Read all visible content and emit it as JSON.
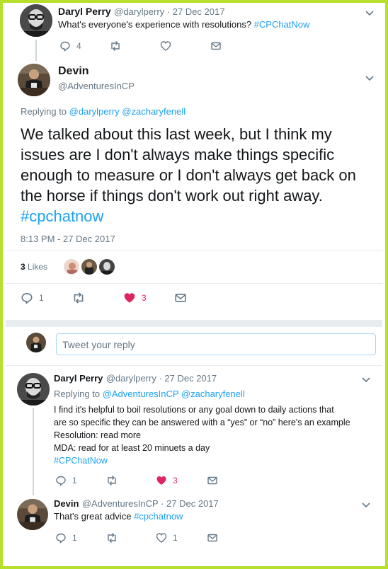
{
  "tweet1": {
    "name": "Daryl Perry",
    "handle_time": "@darylperry · 27 Dec 2017",
    "text": "What's everyone's experience with resolutions?",
    "hashtag": "#CPChatNow",
    "replies": "4"
  },
  "main": {
    "name": "Devin",
    "handle": "@AdventuresInCP",
    "replying_prefix": "Replying to",
    "reply_to_1": "@darylperry",
    "reply_to_2": "@zacharyfenell",
    "text": "We talked about this last week, but I think my issues are I don't always make things specific enough to measure or I don't always get back on the horse if things don't work out right away.",
    "hashtag": "#cpchatnow",
    "timestamp": "8:13 PM - 27 Dec 2017",
    "likes_count": "3",
    "likes_label": "Likes",
    "replies": "1",
    "likes": "3"
  },
  "compose": {
    "placeholder": "Tweet your reply"
  },
  "reply1": {
    "name": "Daryl Perry",
    "handle_time": "@darylperry · 27 Dec 2017",
    "replying_prefix": "Replying to",
    "reply_to_1": "@AdventuresInCP",
    "reply_to_2": "@zacharyfenell",
    "line1": "I find it's helpful to boil resolutions or any goal down to daily actions that",
    "line2": "are so specific they can be answered with a “yes” or “no”  here's an example",
    "line3": "Resolution: read more",
    "line4": "MDA: read for at least 20 minuets a day",
    "hashtag": "#CPChatNow",
    "replies": "1",
    "likes": "3"
  },
  "reply2": {
    "name": "Devin",
    "handle_time": "@AdventuresInCP · 27 Dec 2017",
    "text": "That's great advice",
    "hashtag": "#cpchatnow",
    "replies": "1",
    "likes": "1"
  },
  "colors": {
    "frame": "#b6e02c",
    "link": "#1da1f2",
    "like_active": "#e0245e",
    "muted": "#657786"
  }
}
